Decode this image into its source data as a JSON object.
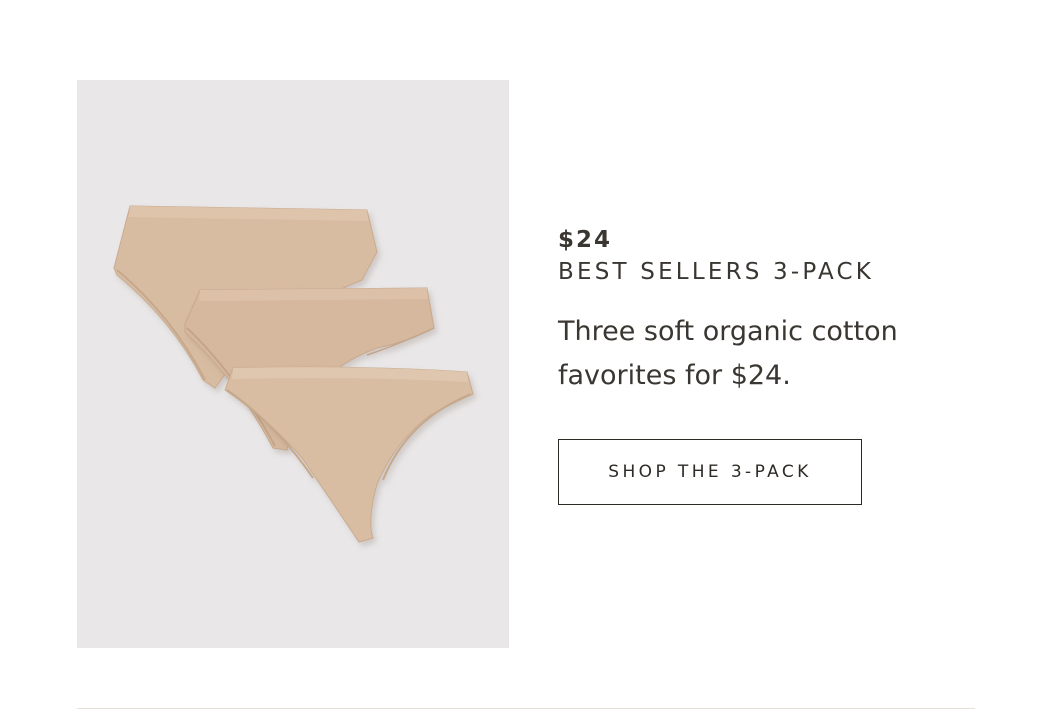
{
  "product": {
    "image_alt": "Three nude organic cotton underwear styles laid out in a stack",
    "price": "$24",
    "title": "BEST SELLERS 3-PACK",
    "description": "Three soft organic cotton favorites for $24.",
    "cta_label": "SHOP THE 3-PACK"
  },
  "colors": {
    "image_background": "#e9e7e8",
    "fabric": "#d8bca2",
    "text": "#3a3631",
    "divider": "#e6e1d8"
  }
}
